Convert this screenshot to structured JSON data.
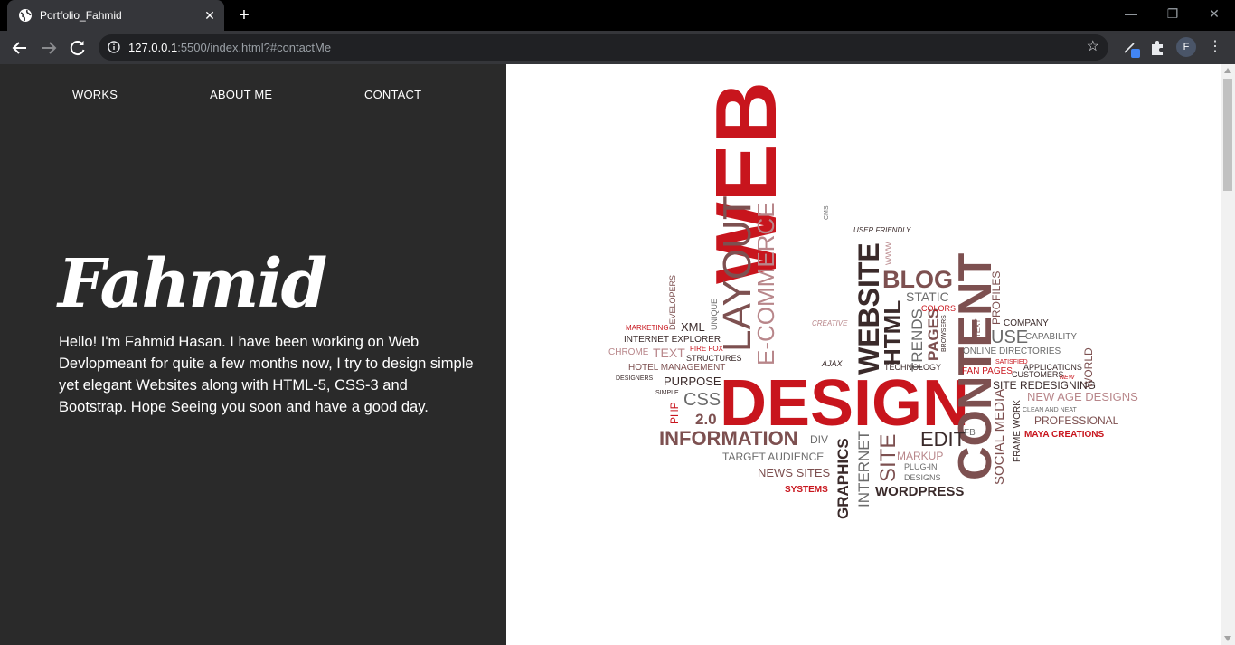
{
  "browser": {
    "tab_title": "Portfolio_Fahmid",
    "url_host": "127.0.0.1",
    "url_rest": ":5500/index.html?#contactMe",
    "profile_initial": "F"
  },
  "nav": {
    "works": "WORKS",
    "about": "ABOUT ME",
    "contact": "CONTACT"
  },
  "hero": {
    "name": "Fahmid",
    "bio": "Hello! I'm Fahmid Hasan. I have been working on Web Devlopmeant for quite a few months now, I try to design simple yet elegant Websites along with HTML-5, CSS-3 and Bootstrap. Hope Seeing you soon and have a good day."
  },
  "word_cloud": {
    "words": [
      "WEB",
      "DESIGN",
      "LAYOUT",
      "E-COMMERCE",
      "WEBSITE",
      "CONTENT",
      "BLOG",
      "HTML",
      "STATIC",
      "TRENDS",
      "PAGES",
      "COLORS",
      "BROWSERS",
      "TEXT",
      "PROFILES",
      "COMPANY",
      "USE",
      "CAPABILITY",
      "ONLINE DIRECTORIES",
      "SATISFIED",
      "APPLICATIONS",
      "CUSTOMERS",
      "NEW",
      "FAN PAGES",
      "WORLD",
      "SITE REDESIGNING",
      "NEW AGE DESIGNS",
      "CLEAN AND NEAT",
      "PROFESSIONAL",
      "MAYA CREATIONS",
      "SOCIAL MEDIA",
      "FRAME WORK",
      "FB",
      "EDIT",
      "MARKUP",
      "PLUG-IN",
      "DESIGNS",
      "WORDPRESS",
      "SITE",
      "INTERNET",
      "GRAPHICS",
      "DIV",
      "INFORMATION",
      "2.0",
      "CSS",
      "PHP",
      "SIMPLE",
      "PURPOSE",
      "DESIGNERS",
      "HOTEL MANAGEMENT",
      "STRUCTURES",
      "CHROME",
      "TEXT",
      "FIRE FOX",
      "INTERNET EXPLORER",
      "XML",
      "MARKETING",
      "DEVELOPERS",
      "UNIQUE",
      "CMS",
      "USER FRIENDLY",
      "WWW",
      "CREATIVE",
      "AJAX",
      "TECHNOLOGY",
      "TARGET AUDIENCE",
      "NEWS SITES",
      "SYSTEMS"
    ],
    "colors": {
      "red": "#c8151d",
      "dark": "#3a2a2a",
      "brown": "#7d5050",
      "gray": "#6b6b6b",
      "pink": "#b8868a"
    }
  }
}
